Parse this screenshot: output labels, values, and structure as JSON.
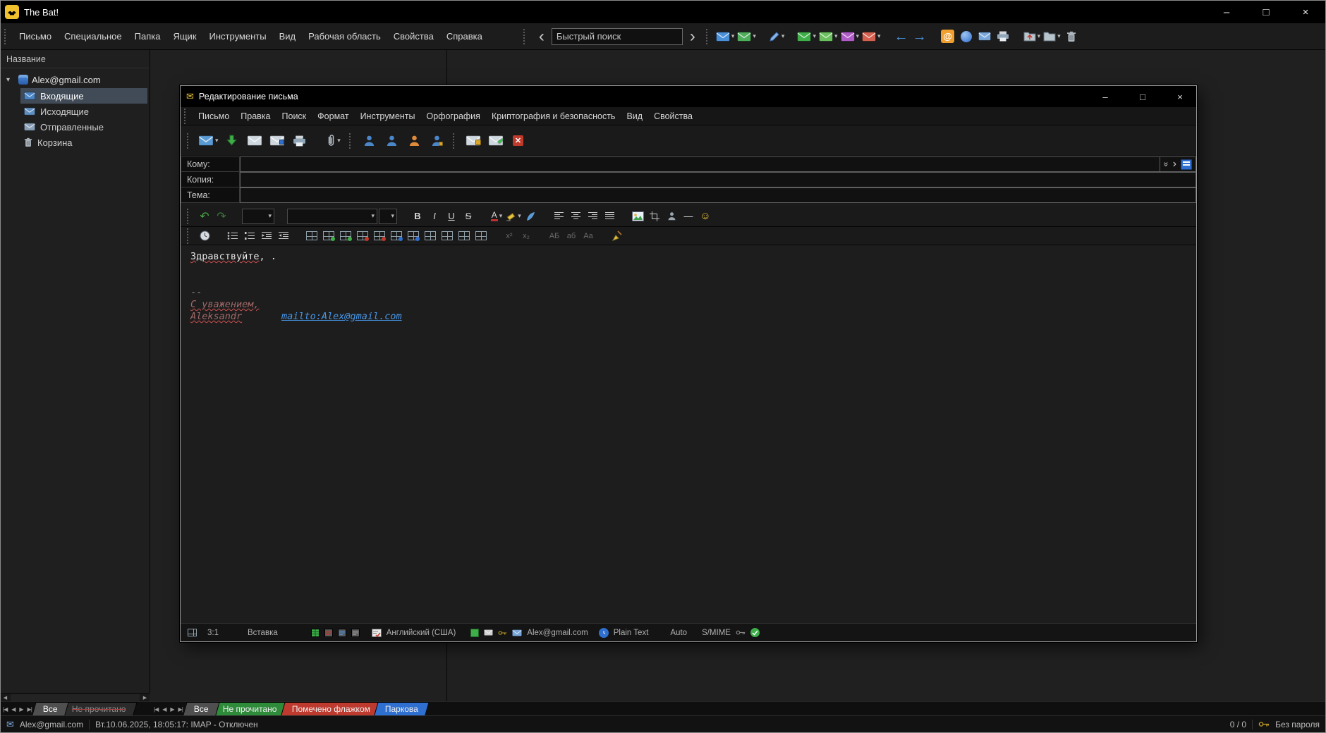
{
  "app": {
    "title": "The Bat!"
  },
  "window_controls": {
    "minimize": "–",
    "maximize": "□",
    "close": "×"
  },
  "glyphs": {
    "dropdown": "▾",
    "expander": "▾",
    "search_prev": "‹",
    "search_next": "›",
    "nav_first": "|◀",
    "nav_prev": "◀",
    "nav_next": "▶",
    "nav_last": "▶|",
    "scroll_left": "◀",
    "scroll_right": "▶",
    "back_arrow": "←",
    "forward_arrow": "→",
    "at_sign": "@",
    "envelope": "✉",
    "undo": "↶",
    "redo": "↷",
    "bold": "B",
    "italic": "I",
    "underline": "U",
    "strike": "S",
    "font_color": "А",
    "horizontal_rule": "—",
    "smiley": "☺",
    "superscript": "x²",
    "subscript": "x₂",
    "letters_upper": "АБ",
    "letters_lower": "аб",
    "letters_mixed": "Аа",
    "exit_cross": "✕",
    "check": "✔",
    "expand_recipients": "»",
    "next_recipient": "›"
  },
  "menubar": {
    "items": [
      "Письмо",
      "Специальное",
      "Папка",
      "Ящик",
      "Инструменты",
      "Вид",
      "Рабочая область",
      "Свойства",
      "Справка"
    ]
  },
  "search": {
    "value": "Быстрый поиск"
  },
  "sidebar": {
    "header": "Название",
    "account": "Alex@gmail.com",
    "folders": [
      "Входящие",
      "Исходящие",
      "Отправленные",
      "Корзина"
    ]
  },
  "folder_tabs": {
    "tabs": [
      "Все",
      "Не прочитано"
    ]
  },
  "message_tabs": {
    "tabs": [
      "Все",
      "Не прочитано",
      "Помечено флажком",
      "Паркова"
    ]
  },
  "compose": {
    "title": "Редактирование письма",
    "menu": [
      "Письмо",
      "Правка",
      "Поиск",
      "Формат",
      "Инструменты",
      "Орфография",
      "Криптография и безопасность",
      "Вид",
      "Свойства"
    ],
    "fields": {
      "to_label": "Кому:",
      "to_value": "",
      "cc_label": "Копия:",
      "cc_value": "",
      "subject_label": "Тема:",
      "subject_value": ""
    },
    "body": {
      "greeting_word": "Здравствуйте",
      "greeting_rest": ", .",
      "sig_delimiter": "--",
      "sig_line1": "С уважением,",
      "sig_line2": "Aleksandr",
      "sig_link": "mailto:Alex@gmail.com"
    },
    "statusbar": {
      "cursor_position": "3:1",
      "mode": "Вставка",
      "language": "Английский (США)",
      "account": "Alex@gmail.com",
      "format": "Plain Text",
      "charset": "Auto",
      "security": "S/MIME"
    }
  },
  "statusbar": {
    "account": "Alex@gmail.com",
    "connection": "Вт.10.06.2025, 18:05:17: IMAP  - Отключен",
    "counter": "0 / 0",
    "password": "Без пароля"
  },
  "colors": {
    "accent_blue": "#4a90d9",
    "green": "#3fae49",
    "red": "#bf3a2e",
    "magenta": "#b05cc6",
    "tab_green": "#2e8b3a",
    "tab_red": "#bf3a2e",
    "tab_blue": "#2f6fd0",
    "link": "#4796e8",
    "highlight_yellow": "#f2c12e"
  }
}
